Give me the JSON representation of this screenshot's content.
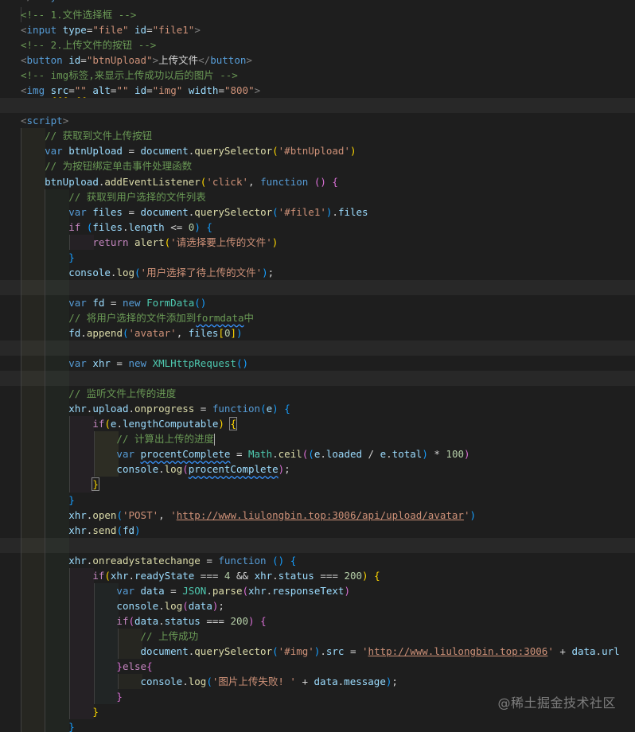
{
  "window": {
    "title": "HTML code editor"
  },
  "code": {
    "lines": [
      "</body>",
      "<!-- 1.文件选择框 -->",
      "<input type=\"file\" id=\"file1\">",
      "<!-- 2.上传文件的按钮 -->",
      "<button id=\"btnUpload\">上传文件</button>",
      "<!-- img标签,来显示上传成功以后的图片 -->",
      "<img src=\"\" alt=\"\" id=\"img\" width=\"800\">",
      "",
      "<script>",
      "    // 获取到文件上传按钮",
      "    var btnUpload = document.querySelector('#btnUpload')",
      "    // 为按钮绑定单击事件处理函数",
      "    btnUpload.addEventListener('click', function () {",
      "        // 获取到用户选择的文件列表",
      "        var files = document.querySelector('#file1').files",
      "        if (files.length <= 0) {",
      "            return alert('请选择要上传的文件')",
      "        }",
      "        console.log('用户选择了待上传的文件');",
      "",
      "        var fd = new FormData()",
      "        // 将用户选择的文件添加到formdata中",
      "        fd.append('avatar', files[0])",
      "",
      "        var xhr = new XMLHttpRequest()",
      "",
      "        // 监听文件上传的进度",
      "        xhr.upload.onprogress = function(e) {",
      "            if(e.lengthComputable) {",
      "                // 计算出上传的进度",
      "                var procentComplete = Math.ceil((e.loaded / e.total) * 100)",
      "                console.log(procentComplete);",
      "            }",
      "        }",
      "        xhr.open('POST', 'http://www.liulongbin.top:3006/api/upload/avatar')",
      "        xhr.send(fd)",
      "",
      "        xhr.onreadystatechange = function () {",
      "            if(xhr.readyState === 4 && xhr.status === 200) {",
      "                var data = JSON.parse(xhr.responseText)",
      "                console.log(data);",
      "                if(data.status === 200) {",
      "                    // 上传成功",
      "                    document.querySelector('#img').src = 'http://www.liulongbin.top:3006' + data.url",
      "                }else{",
      "                    console.log('图片上传失败! ' + data.message);",
      "                }",
      "            }",
      "        }"
    ]
  },
  "watermark": {
    "text": "@稀土掘金技术社区"
  },
  "colors": {
    "background": "#1e1e1e",
    "comment": "#6a9955",
    "tag": "#569cd6",
    "attribute": "#9cdcfe",
    "string": "#ce9178",
    "function": "#dcdcaa",
    "class": "#4ec9b0",
    "number": "#b5cea8",
    "control": "#c586c0"
  }
}
